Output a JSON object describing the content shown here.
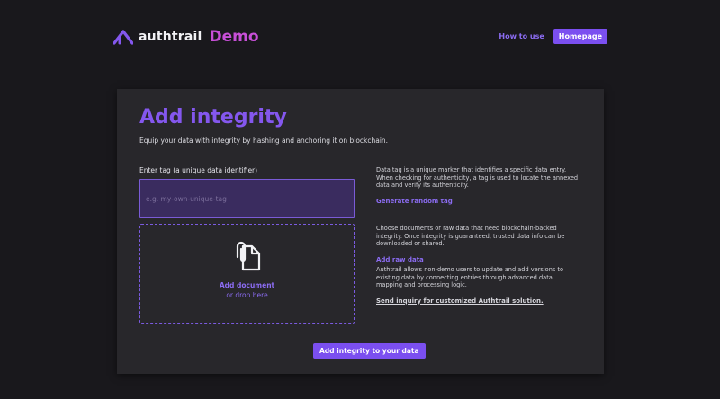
{
  "header": {
    "logo_text": "authtrail",
    "logo_suffix": "Demo",
    "logo_icon": "authtrail-logo-icon",
    "nav": {
      "how_to_use": "How to use",
      "homepage": "Homepage"
    }
  },
  "card": {
    "title": "Add integrity",
    "subtitle": "Equip your data with integrity by hashing and anchoring it on blockchain.",
    "tag": {
      "label": "Enter tag (a unique data identifier)",
      "placeholder": "e.g. my-own-unique-tag",
      "value": ""
    },
    "dropzone": {
      "icon": "attach-document-icon",
      "line1": "Add document",
      "line2": "or drop here"
    },
    "info": {
      "tag_desc": "Data tag is a unique marker that identifies a specific data entry. When checking for authenticity, a tag is used to locate the annexed data and verify its authenticity.",
      "tag_link": "Generate random tag",
      "doc_desc": "Choose documents or raw data that need blockchain-backed integrity. Once integrity is guaranteed, trusted data info can be downloaded or shared.",
      "doc_link": "Add raw data",
      "custom_desc": "Authtrail allows non-demo users to update and add versions to existing data by connecting entries through advanced data mapping and processing logic.",
      "custom_link": "Send inquiry for customized Authtrail solution."
    },
    "submit_label": "Add integrity to your data"
  },
  "colors": {
    "accent": "#7b4ff0",
    "title": "#8457ee",
    "demo": "#c84fd8",
    "background": "#19181c",
    "card": "#28272b"
  }
}
